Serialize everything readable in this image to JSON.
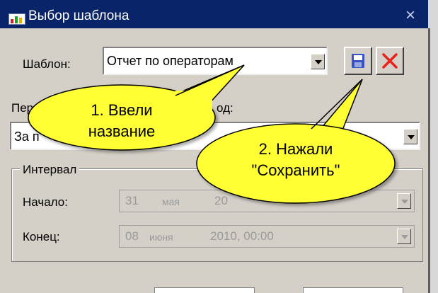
{
  "window": {
    "title": "Выбор шаблона",
    "close_glyph": "×"
  },
  "template": {
    "label": "Шаблон:",
    "value": "Отчет по операторам"
  },
  "period": {
    "label": "Период:",
    "label_tail": "од:",
    "value": "За п"
  },
  "interval": {
    "title": "Интервал",
    "start": {
      "label": "Начало:",
      "day": "31",
      "month": "мая",
      "year_time": "20"
    },
    "end": {
      "label": "Конец:",
      "day": "08",
      "month": "июня",
      "year_time": "2010, 00:00"
    }
  },
  "callouts": [
    {
      "lines": [
        "1. Ввели",
        "название"
      ]
    },
    {
      "lines": [
        "2. Нажали",
        "\"Сохранить\""
      ]
    }
  ],
  "icons": {
    "save": "floppy-disk-icon",
    "delete": "red-x-icon",
    "dropdown": "dropdown-arrow-icon"
  },
  "colors": {
    "titlebar": "#0a246a",
    "bubble": "#ffff33",
    "delete": "#e8211a",
    "save": "#3a52c8"
  }
}
